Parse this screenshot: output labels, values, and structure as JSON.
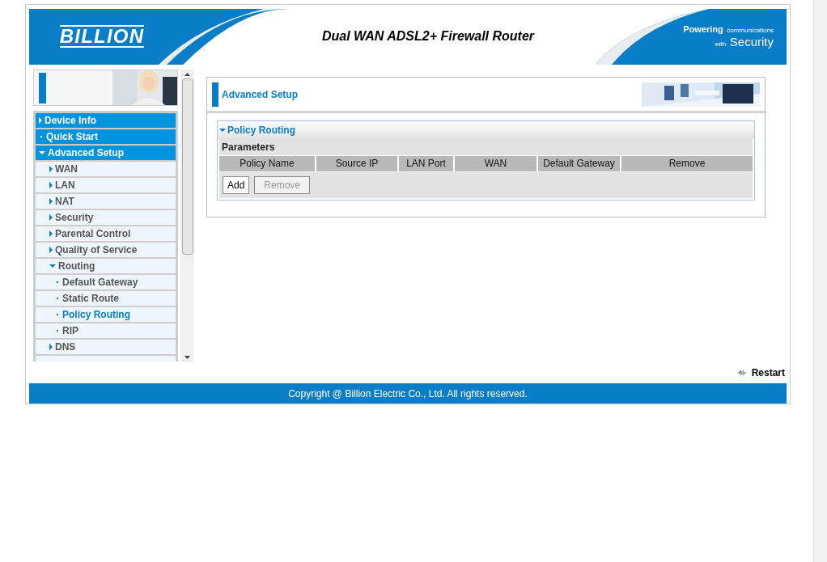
{
  "header": {
    "logo": "BILLION",
    "title": "Dual WAN ADSL2+ Firewall Router",
    "tagline_1": "Powering",
    "tagline_2": "communications",
    "tagline_3": "with",
    "tagline_4": "Security"
  },
  "sidebar": {
    "items": [
      {
        "label": "Device Info",
        "expanded": false,
        "selected": false
      },
      {
        "label": "Quick Start",
        "selected": false
      },
      {
        "label": "Advanced Setup",
        "expanded": true,
        "selected": false,
        "children": [
          {
            "label": "WAN",
            "expanded": false,
            "selected": false
          },
          {
            "label": "LAN",
            "expanded": false,
            "selected": false
          },
          {
            "label": "NAT",
            "expanded": false,
            "selected": false
          },
          {
            "label": "Security",
            "expanded": false,
            "selected": false
          },
          {
            "label": "Parental Control",
            "expanded": false,
            "selected": false
          },
          {
            "label": "Quality of Service",
            "expanded": false,
            "selected": false
          },
          {
            "label": "Routing",
            "expanded": true,
            "selected": false,
            "children": [
              {
                "label": "Default Gateway",
                "selected": false
              },
              {
                "label": "Static Route",
                "selected": false
              },
              {
                "label": "Policy Routing",
                "selected": true
              },
              {
                "label": "RIP",
                "selected": false
              }
            ]
          },
          {
            "label": "DNS",
            "expanded": false,
            "selected": false
          }
        ]
      }
    ]
  },
  "page": {
    "title": "Advanced Setup",
    "section": {
      "title": "Policy Routing",
      "expanded": true,
      "subtitle": "Parameters",
      "table": {
        "columns": [
          "Policy Name",
          "Source IP",
          "LAN Port",
          "WAN",
          "Default Gateway",
          "Remove"
        ]
      },
      "buttons": [
        {
          "label": "Add",
          "disabled": false
        },
        {
          "label": "Remove",
          "disabled": true
        }
      ]
    }
  },
  "restart": "Restart",
  "footer": "Copyright @ Billion Electric Co., Ltd. All rights reserved."
}
